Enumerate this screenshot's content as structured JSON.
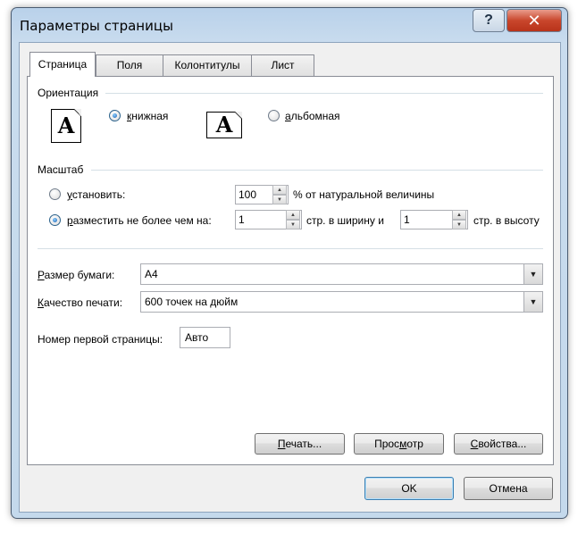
{
  "window": {
    "title": "Параметры страницы",
    "help_label": "?",
    "close_label": "✕"
  },
  "tabs": [
    {
      "label": "Страница",
      "active": true
    },
    {
      "label": "Поля",
      "active": false
    },
    {
      "label": "Колонтитулы",
      "active": false
    },
    {
      "label": "Лист",
      "active": false
    }
  ],
  "orientation": {
    "section_label": "Ориентация",
    "portrait": {
      "label_pre": "",
      "label_u": "к",
      "label_post": "нижная",
      "selected": true,
      "icon_letter": "A"
    },
    "landscape": {
      "label_pre": "",
      "label_u": "а",
      "label_post": "льбомная",
      "selected": false,
      "icon_letter": "A"
    }
  },
  "scale": {
    "section_label": "Масштаб",
    "adjust": {
      "label_pre": "",
      "label_u": "у",
      "label_post": "становить:",
      "selected": false,
      "value": "100",
      "suffix": "% от натуральной величины"
    },
    "fit": {
      "label_pre": "",
      "label_u": "р",
      "label_post": "азместить не более чем на:",
      "selected": true,
      "wide_value": "1",
      "wide_suffix": "стр. в ширину и",
      "tall_value": "1",
      "tall_suffix": "стр. в высоту"
    }
  },
  "paper": {
    "size_label_pre": "",
    "size_label_u": "Р",
    "size_label_post": "азмер бумаги:",
    "size_value": "A4",
    "quality_label_pre": "",
    "quality_label_u": "К",
    "quality_label_post": "ачество печати:",
    "quality_value": "600 точек на дюйм",
    "first_page_label": "Номер первой страницы:",
    "first_page_value": "Авто"
  },
  "panel_buttons": {
    "print_pre": "",
    "print_u": "П",
    "print_post": "ечать...",
    "preview_pre": "Прос",
    "preview_u": "м",
    "preview_post": "отр",
    "options_pre": "",
    "options_u": "С",
    "options_post": "войства..."
  },
  "dialog_buttons": {
    "ok": "OK",
    "cancel": "Отмена"
  }
}
